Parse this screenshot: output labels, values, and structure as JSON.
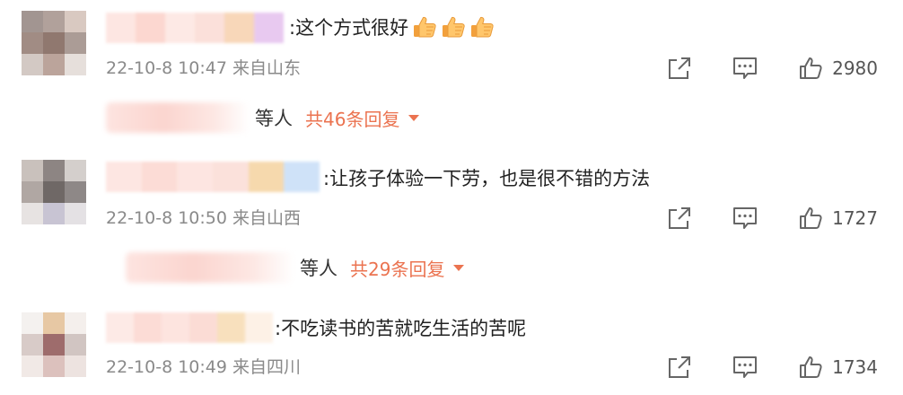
{
  "colors": {
    "accent": "#eb7350",
    "meta_text": "#8a8a8a",
    "icon": "#666666"
  },
  "comments": [
    {
      "separator": ":",
      "text": "这个方式很好",
      "emoji": [
        "thumbs-up-emoji",
        "thumbs-up-emoji",
        "thumbs-up-emoji"
      ],
      "time": "22-10-8 10:47",
      "location": "来自山东",
      "likes": "2980",
      "reply_suffix": "等人",
      "reply_link": "共46条回复",
      "avatar_colors": [
        "#a29591",
        "#b1a19b",
        "#d9c9c1",
        "#a18c84",
        "#90786f",
        "#ab9c96",
        "#d3c9c4",
        "#bba49b",
        "#e6dfdb"
      ],
      "name_colors": [
        "#fde6e2",
        "#fcd7d0",
        "#fde9e5",
        "#fbe0da",
        "#f8d7b9",
        "#e8c9f0"
      ]
    },
    {
      "separator": ":",
      "text": "让孩子体验一下劳，也是很不错的方法",
      "time": "22-10-8 10:50",
      "location": "来自山西",
      "likes": "1727",
      "reply_suffix": "等人",
      "reply_link": "共29条回复",
      "avatar_colors": [
        "#c9c1bc",
        "#8d8583",
        "#d4cfcc",
        "#b0a7a3",
        "#6f6866",
        "#8e8887",
        "#e7e3e2",
        "#c8c4d3",
        "#e4e1e4"
      ],
      "name_colors": [
        "#fde6e2",
        "#fcdcd6",
        "#fde5e1",
        "#fbe1db",
        "#f6d9ad",
        "#cfe2f8"
      ]
    },
    {
      "separator": ":",
      "text": "不吃读书的苦就吃生活的苦呢",
      "time": "22-10-8 10:49",
      "location": "来自四川",
      "likes": "1734",
      "avatar_colors": [
        "#f4f1ef",
        "#e7c8a4",
        "#f4efec",
        "#d8cbc8",
        "#9e6c6c",
        "#d1c5c2",
        "#f1e9e6",
        "#dcc1bd",
        "#ede3e0"
      ],
      "name_colors": [
        "#fdeae6",
        "#fcdcd6",
        "#fde4df",
        "#fbdcd5",
        "#f8e0bd",
        "#fdf1e6"
      ]
    }
  ]
}
